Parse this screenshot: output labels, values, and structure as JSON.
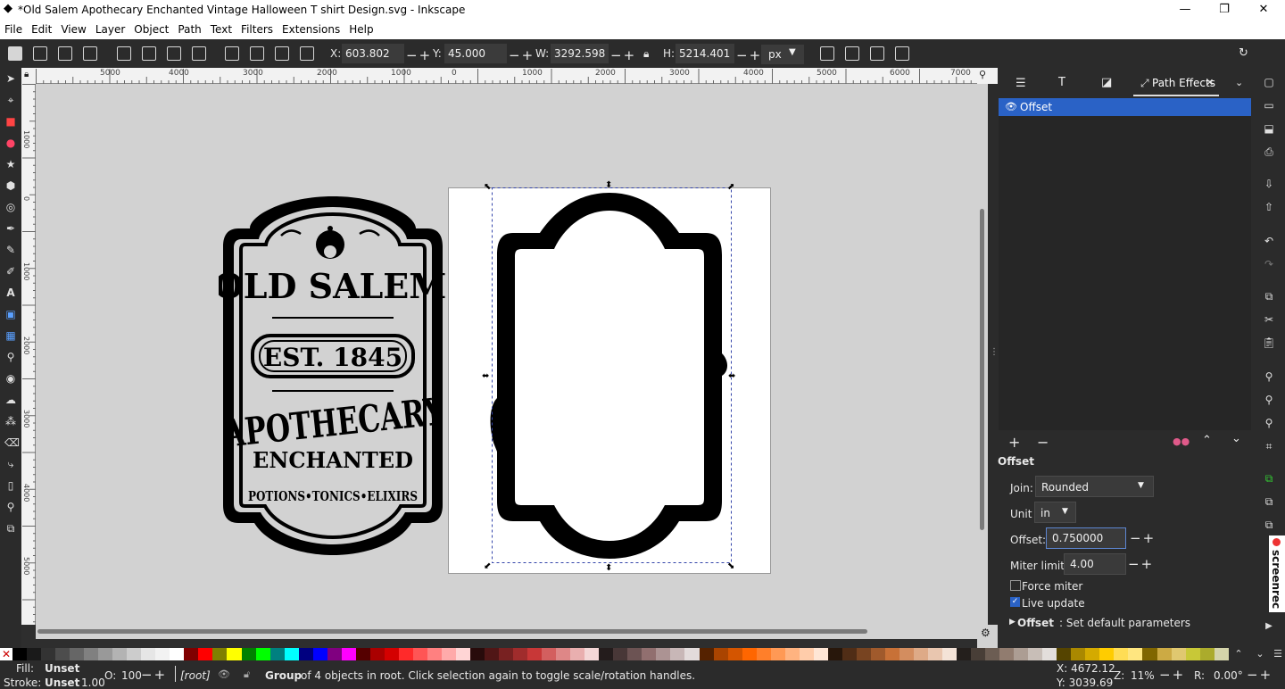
{
  "window": {
    "title": "*Old Salem Apothecary Enchanted Vintage Halloween T shirt Design.svg - Inkscape"
  },
  "menu": [
    "File",
    "Edit",
    "View",
    "Layer",
    "Object",
    "Path",
    "Text",
    "Filters",
    "Extensions",
    "Help"
  ],
  "toolbar": {
    "x_label": "X:",
    "x_value": "603.802",
    "y_label": "Y:",
    "y_value": "45.000",
    "w_label": "W:",
    "w_value": "3292.598",
    "h_label": "H:",
    "h_value": "5214.401",
    "unit": "px"
  },
  "rulers": {
    "h_labels": [
      "5000",
      "4000",
      "3000",
      "2000",
      "1000",
      "0",
      "1000",
      "2000",
      "3000",
      "4000",
      "5000",
      "6000",
      "7000"
    ],
    "v_labels": [
      "1000",
      "0",
      "1000",
      "2000",
      "3000",
      "4000",
      "5000"
    ]
  },
  "design_text": {
    "line1": "OLD SALEM",
    "line2": "EST. 1845",
    "line3": "APOTHECARY",
    "line4": "ENCHANTED",
    "line5": "POTIONS•TONICS•ELIXIRS"
  },
  "dock": {
    "tab_active": "Path Effects",
    "effect_item": "Offset",
    "section_title": "Offset",
    "join_label": "Join:",
    "join_value": "Rounded",
    "unit_label": "Unit",
    "unit_value": "in",
    "offset_label": "Offset:",
    "offset_value": "0.750000",
    "miter_label": "Miter limit:",
    "miter_value": "4.00",
    "force_miter": "Force miter",
    "live_update": "Live update",
    "footer_bold": "Offset",
    "footer_rest": ": Set default parameters",
    "watermark": "screenrec"
  },
  "status": {
    "fill_label": "Fill:",
    "fill_value": "Unset",
    "stroke_label": "Stroke:",
    "stroke_value": "Unset",
    "stroke_width": "1.00",
    "opacity_label": "O:",
    "opacity_value": "100",
    "layer": "[root]",
    "message_bold": "Group",
    "message_rest": " of 4 objects in root. Click selection again to toggle scale/rotation handles.",
    "x_coord": "X: 4672.12",
    "y_coord": "Y: 3039.69",
    "zoom_label": "Z:",
    "zoom_value": "11%",
    "rot_label": "R:",
    "rot_value": "0.00°"
  },
  "palette_colors": [
    "#000000",
    "#1a1a1a",
    "#333333",
    "#4d4d4d",
    "#666666",
    "#808080",
    "#999999",
    "#b3b3b3",
    "#cccccc",
    "#e6e6e6",
    "#f2f2f2",
    "#ffffff",
    "#800000",
    "#ff0000",
    "#808000",
    "#ffff00",
    "#008000",
    "#00ff00",
    "#008080",
    "#00ffff",
    "#000080",
    "#0000ff",
    "#800080",
    "#ff00ff",
    "#550000",
    "#aa0000",
    "#d40000",
    "#ff2a2a",
    "#ff5555",
    "#ff8080",
    "#ffaaaa",
    "#ffd5d5",
    "#280b0b",
    "#501616",
    "#782121",
    "#a02c2c",
    "#c83737",
    "#d35f5f",
    "#de8787",
    "#e9afaf",
    "#f4d7d7",
    "#241c1c",
    "#483737",
    "#6c5353",
    "#916f6f",
    "#ac9393",
    "#c8b7b7",
    "#e3dbdb",
    "#552200",
    "#aa4400",
    "#d45500",
    "#ff6600",
    "#ff7f2a",
    "#ff9955",
    "#ffb380",
    "#ffccaa",
    "#ffe6d5",
    "#28170b",
    "#502d16",
    "#784421",
    "#a05a2c",
    "#c87137",
    "#d38d5f",
    "#deaa87",
    "#e9c6af",
    "#f4e3d7",
    "#241f1c",
    "#483e37",
    "#6c5d53",
    "#917c6f",
    "#ac9d93",
    "#c8beb7",
    "#e3dedb",
    "#554400",
    "#aa8800",
    "#d4aa00",
    "#ffcc00",
    "#ffdd55",
    "#ffe680",
    "#806600",
    "#ccaa44",
    "#e0c870",
    "#c8c837",
    "#abab2c",
    "#d4d4aa"
  ]
}
